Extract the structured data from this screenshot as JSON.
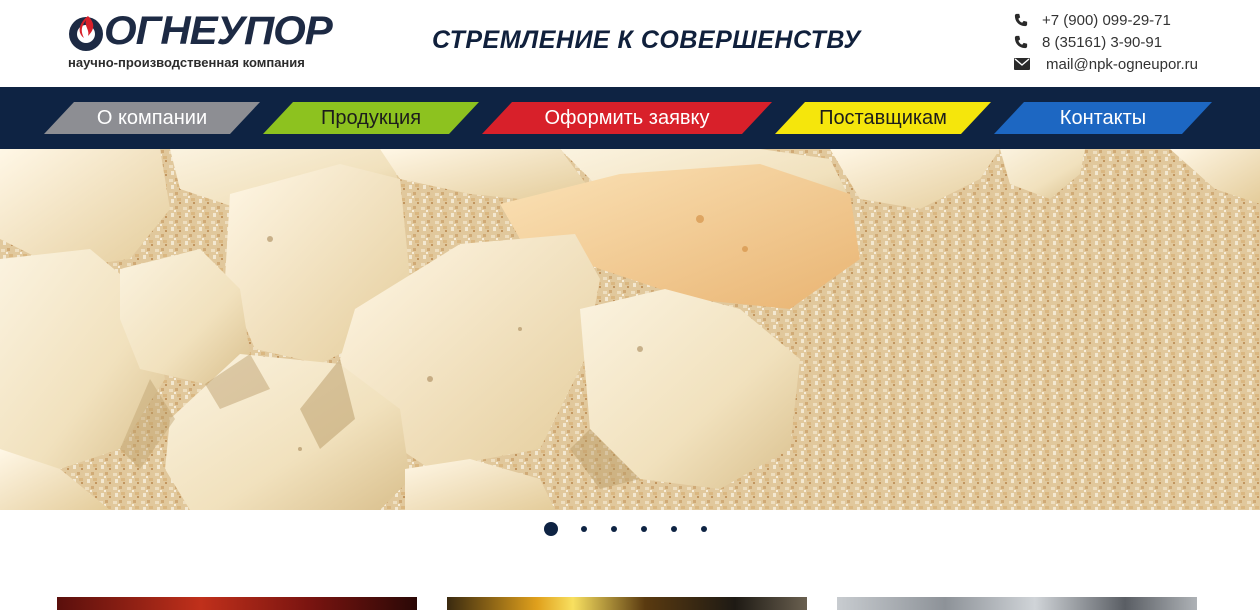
{
  "header": {
    "logo": {
      "word": "ОГНЕУПОР",
      "subtitle": "научно-производственная компания"
    },
    "slogan": "СТРЕМЛЕНИЕ К СОВЕРШЕНСТВУ",
    "contacts": {
      "phone1": "+7 (900) 099-29-71",
      "phone2": "8 (35161) 3-90-91",
      "email": "mail@npk-ogneupor.ru"
    }
  },
  "nav": {
    "items": [
      {
        "label": "О компании",
        "color": "#8d8e93"
      },
      {
        "label": "Продукция",
        "color": "#8dc21f"
      },
      {
        "label": "Оформить заявку",
        "color": "#d8202a"
      },
      {
        "label": "Поставщикам",
        "color": "#f5e60c"
      },
      {
        "label": "Контакты",
        "color": "#1d67c2"
      }
    ]
  },
  "slider": {
    "slide_count": 6,
    "active_index": 0
  },
  "colors": {
    "brand_navy": "#0e2343",
    "brand_red": "#d8202a"
  }
}
